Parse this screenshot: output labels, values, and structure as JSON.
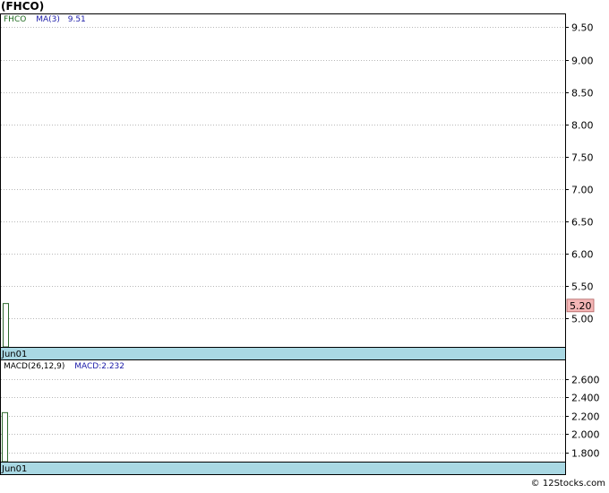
{
  "title": "(FHCO)",
  "watermark": "© 12Stocks.com",
  "colors": {
    "price_candle": "#2f6b2f",
    "price_legend": "#1e6a1e",
    "ma_legend": "#1a1aa8",
    "macd_legend": "#1a1aa8",
    "macd_bar": "#2f6b2f",
    "date_band": "#a9d8e3",
    "last_price_badge": "#f4b6b6",
    "grid": "#b8b8b8"
  },
  "chart_data": [
    {
      "type": "candlestick",
      "name": "price",
      "legend": {
        "symbol": "FHCO",
        "ma_label": "MA(3)",
        "ma_value": "9.51"
      },
      "x": [
        "Jun01"
      ],
      "candles": [
        {
          "x": "Jun01",
          "low": 4.56,
          "high": 5.23
        }
      ],
      "ylim": [
        4.56,
        9.7
      ],
      "ytick_values": [
        9.5,
        9.0,
        8.5,
        8.0,
        7.5,
        7.0,
        6.5,
        6.0,
        5.5,
        5.0
      ],
      "ytick_labels": [
        "9.50",
        "9.00",
        "8.50",
        "8.00",
        "7.50",
        "7.00",
        "6.50",
        "6.00",
        "5.50",
        "5.00"
      ],
      "last_price": "5.20",
      "last_price_value": 5.2,
      "grid": true,
      "xlabel_band": "Jun01"
    },
    {
      "type": "bar",
      "name": "macd",
      "legend": {
        "label": "MACD(26,12,9)",
        "value_label": "MACD:2.232"
      },
      "x": [
        "Jun01"
      ],
      "values": [
        2.232
      ],
      "baseline": 1.7,
      "ylim": [
        1.7,
        2.8
      ],
      "ytick_values": [
        2.6,
        2.4,
        2.2,
        2.0,
        1.8
      ],
      "ytick_labels": [
        "2.600",
        "2.400",
        "2.200",
        "2.000",
        "1.800"
      ],
      "grid": true,
      "xlabel_band": "Jun01"
    }
  ]
}
